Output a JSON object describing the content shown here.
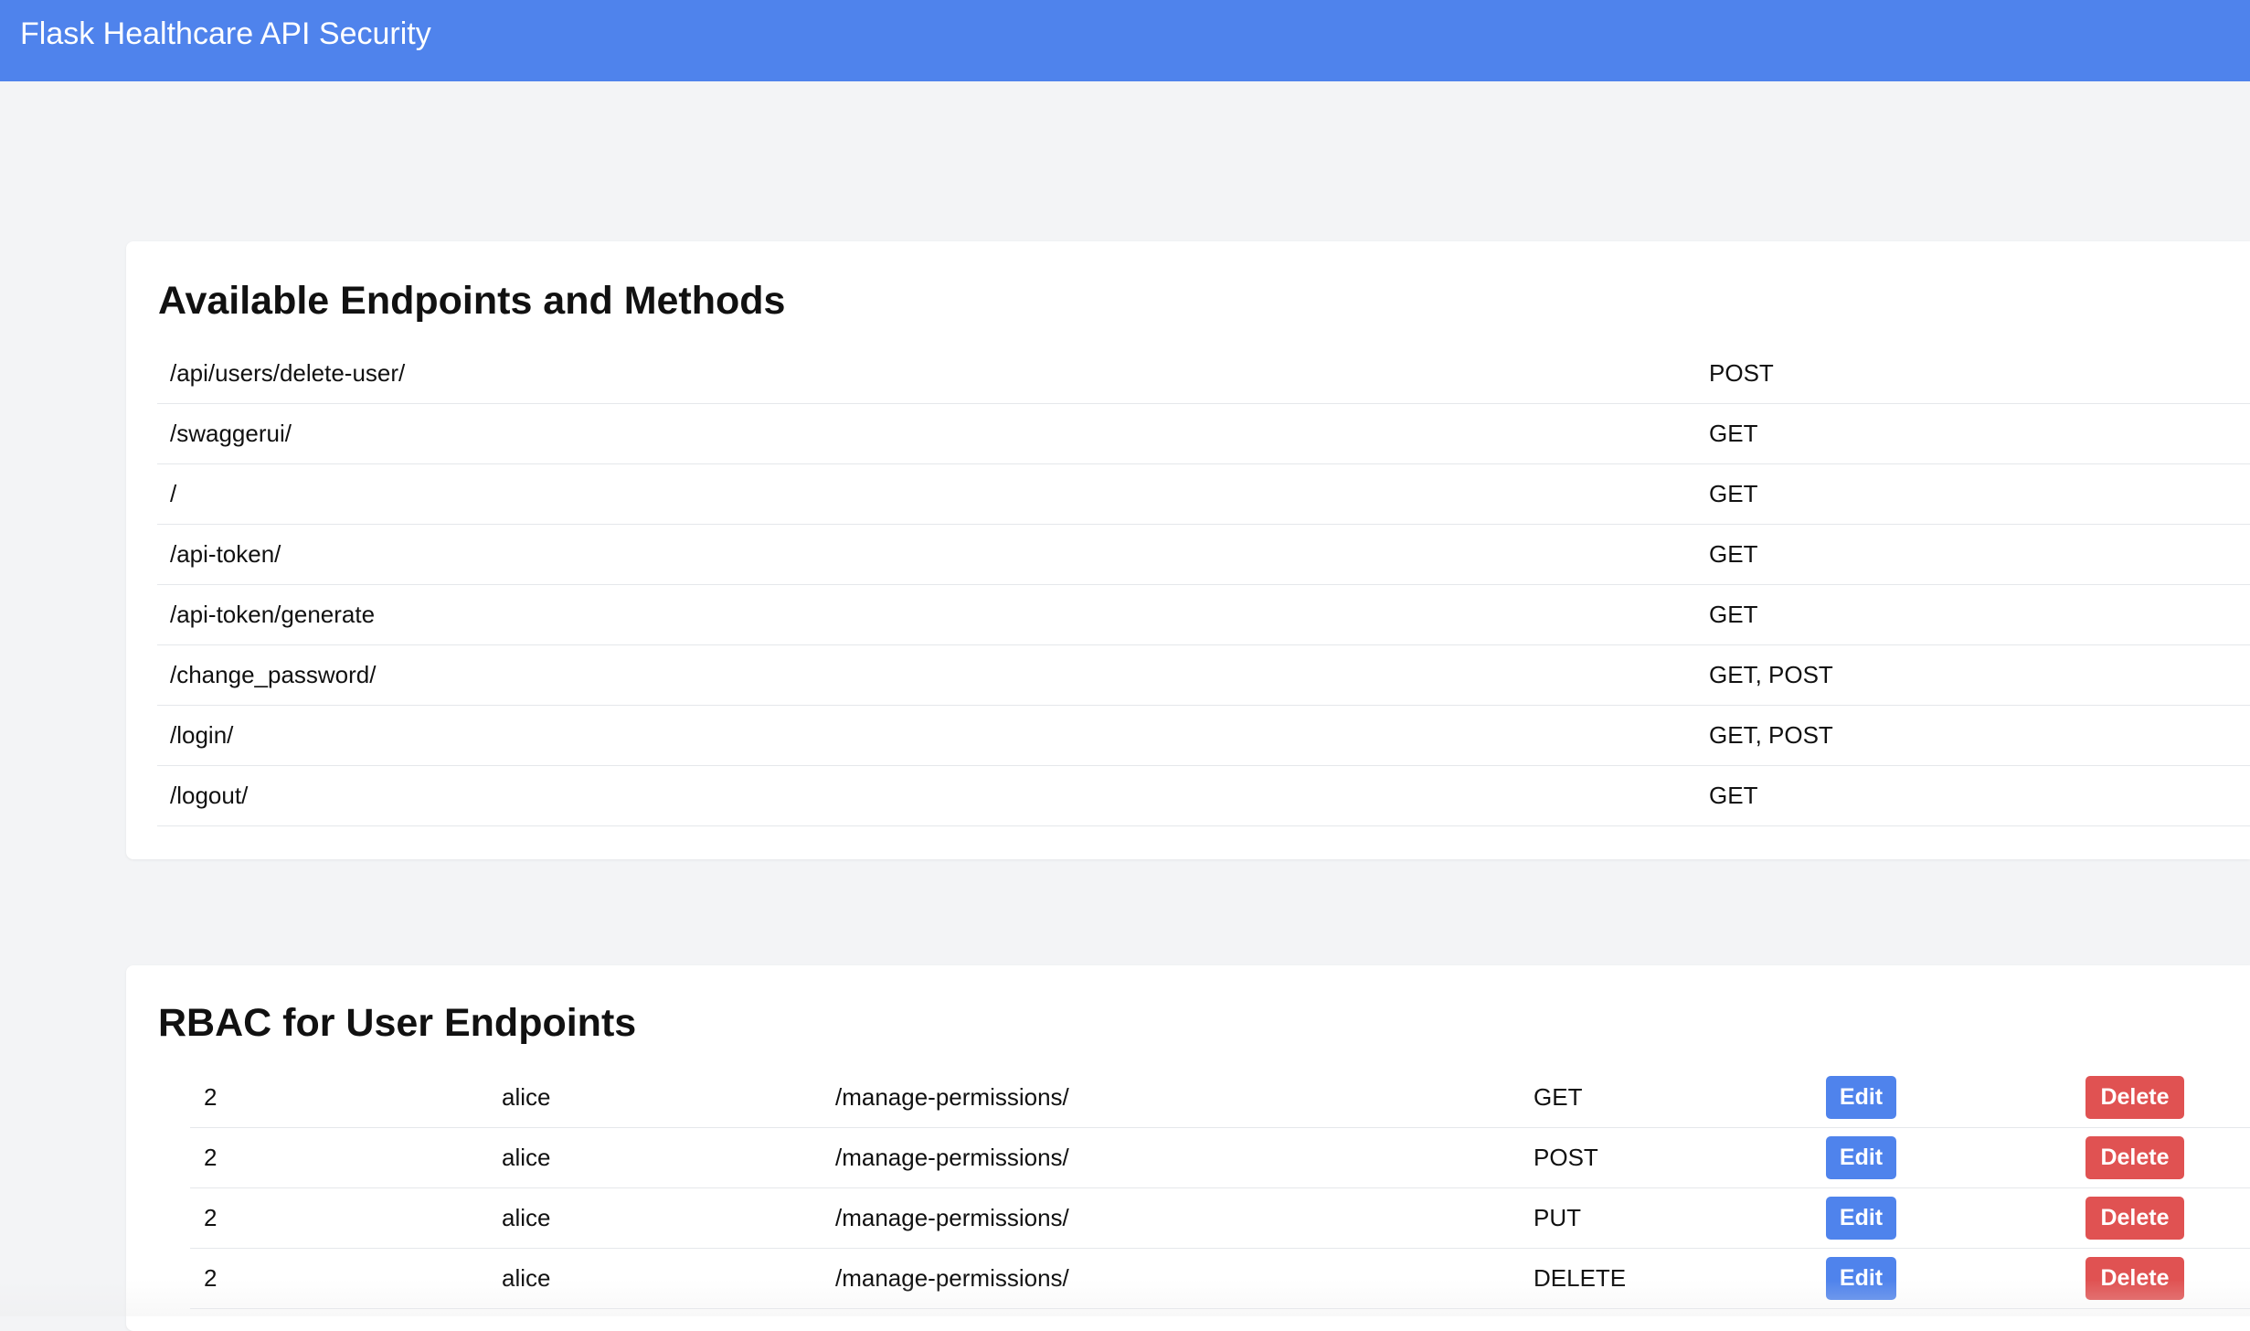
{
  "header": {
    "title": "Flask Healthcare API Security"
  },
  "colors": {
    "primary": "#4f83ec",
    "danger": "#e05252",
    "background": "#f3f4f6"
  },
  "endpoints_section": {
    "title": "Available Endpoints and Methods",
    "rows": [
      {
        "path": "/api/users/delete-user/",
        "methods": "POST"
      },
      {
        "path": "/swaggerui/",
        "methods": "GET"
      },
      {
        "path": "/",
        "methods": "GET"
      },
      {
        "path": "/api-token/",
        "methods": "GET"
      },
      {
        "path": "/api-token/generate",
        "methods": "GET"
      },
      {
        "path": "/change_password/",
        "methods": "GET, POST"
      },
      {
        "path": "/login/",
        "methods": "GET, POST"
      },
      {
        "path": "/logout/",
        "methods": "GET"
      }
    ]
  },
  "rbac_section": {
    "title": "RBAC for User Endpoints",
    "edit_label": "Edit",
    "delete_label": "Delete",
    "rows": [
      {
        "id": "2",
        "user": "alice",
        "endpoint": "/manage-permissions/",
        "method": "GET"
      },
      {
        "id": "2",
        "user": "alice",
        "endpoint": "/manage-permissions/",
        "method": "POST"
      },
      {
        "id": "2",
        "user": "alice",
        "endpoint": "/manage-permissions/",
        "method": "PUT"
      },
      {
        "id": "2",
        "user": "alice",
        "endpoint": "/manage-permissions/",
        "method": "DELETE"
      }
    ]
  }
}
